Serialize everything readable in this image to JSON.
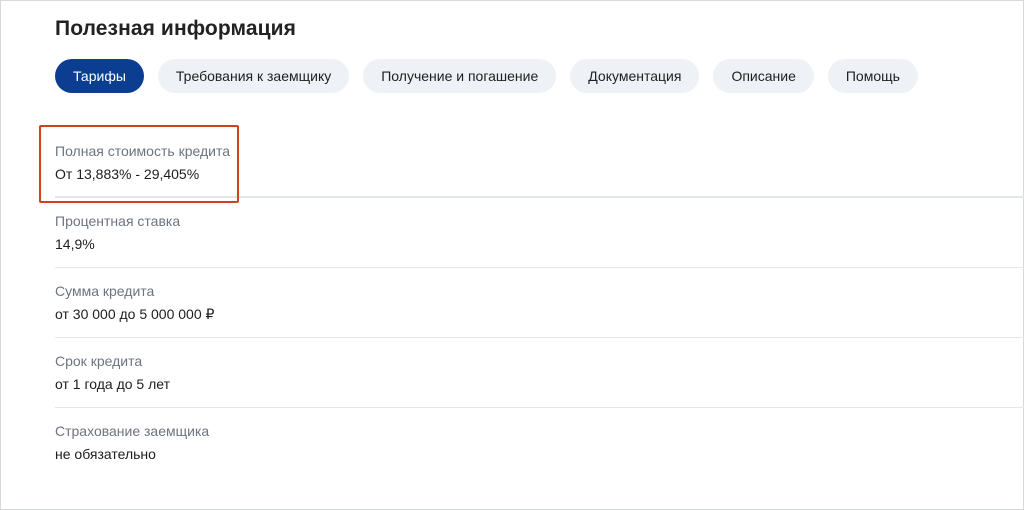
{
  "section": {
    "title": "Полезная информация"
  },
  "tabs": [
    {
      "label": "Тарифы",
      "active": true
    },
    {
      "label": "Требования к заемщику",
      "active": false
    },
    {
      "label": "Получение и погашение",
      "active": false
    },
    {
      "label": "Документация",
      "active": false
    },
    {
      "label": "Описание",
      "active": false
    },
    {
      "label": "Помощь",
      "active": false
    }
  ],
  "rows": [
    {
      "label": "Полная стоимость кредита",
      "value": "От 13,883% - 29,405%"
    },
    {
      "label": "Процентная ставка",
      "value": "14,9%"
    },
    {
      "label": "Сумма кредита",
      "value": "от 30 000 до 5 000 000 ₽"
    },
    {
      "label": "Срок кредита",
      "value": "от 1 года до 5 лет"
    },
    {
      "label": "Страхование заемщика",
      "value": "не обязательно"
    }
  ],
  "colors": {
    "active_tab_bg": "#0b3d91",
    "inactive_tab_bg": "#eef1f5",
    "highlight_border": "#d0421b",
    "label_text": "#6b7480"
  }
}
